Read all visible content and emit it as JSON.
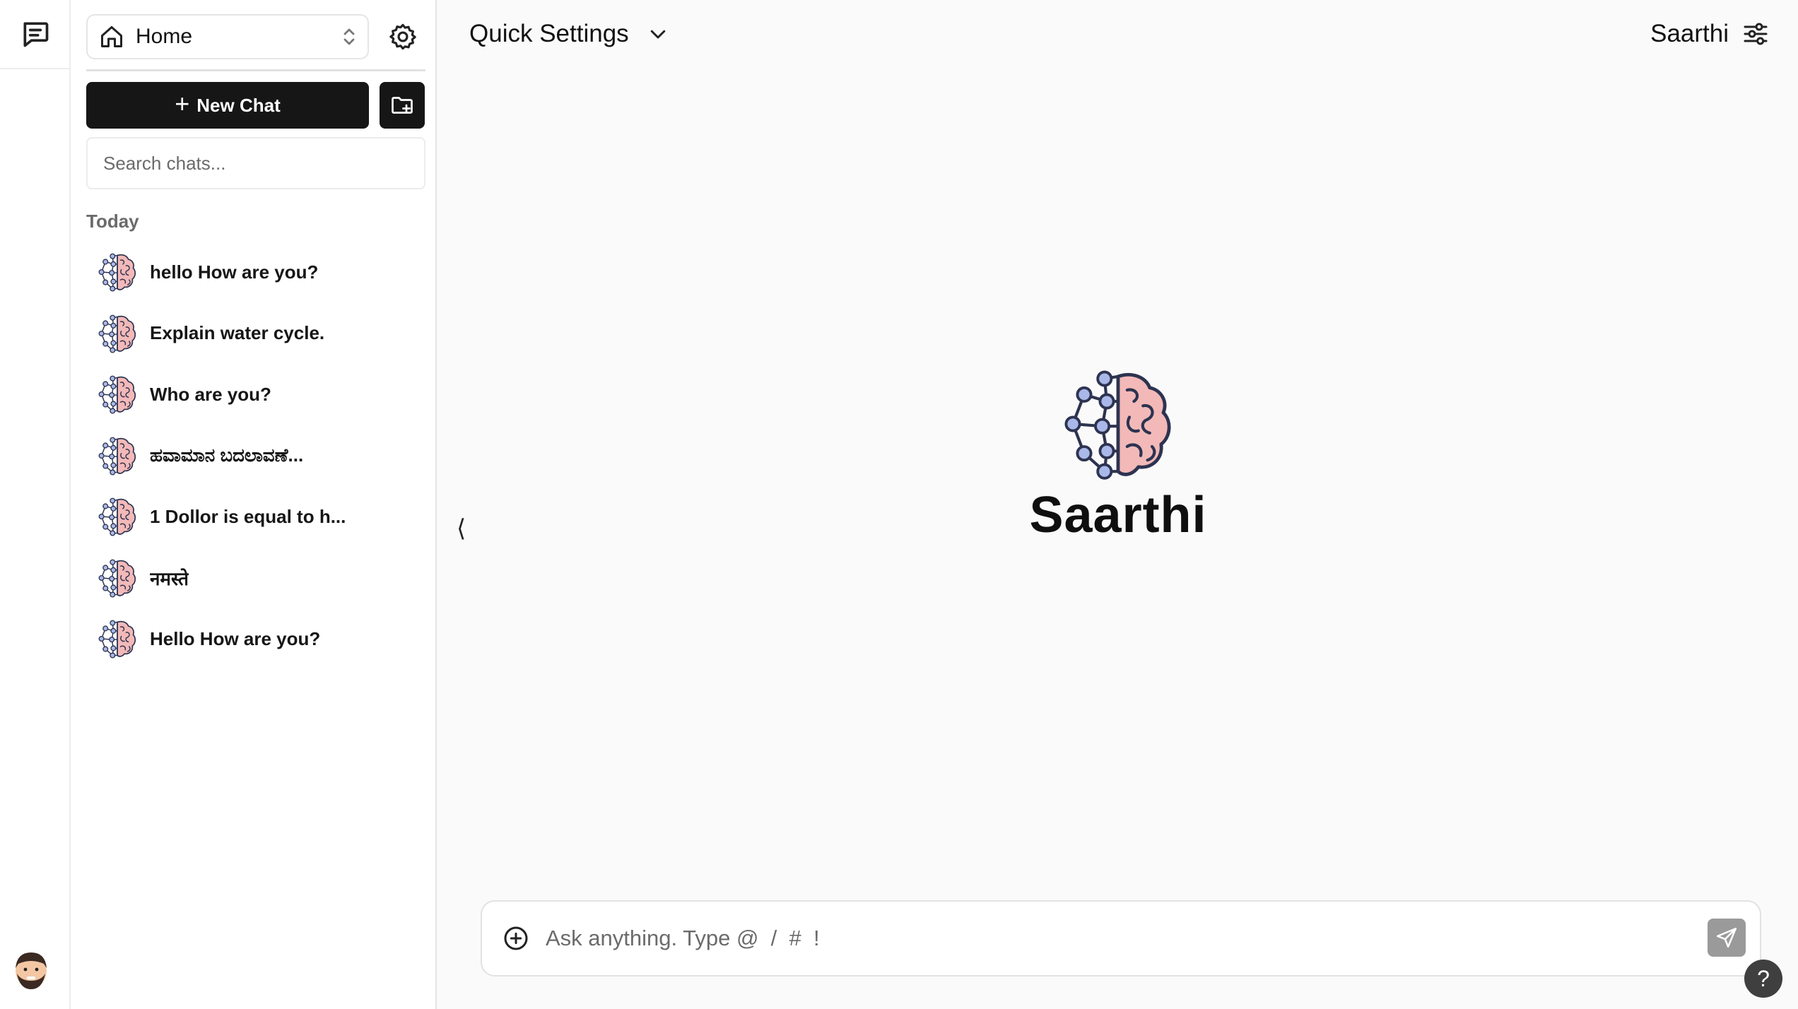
{
  "sidebar": {
    "space_select": {
      "label": "Home",
      "icon": "home-icon"
    },
    "new_chat_label": "New Chat",
    "search": {
      "placeholder": "Search chats..."
    },
    "section_label": "Today",
    "chats": [
      {
        "title": "hello How are you?"
      },
      {
        "title": "Explain water cycle."
      },
      {
        "title": "Who are you?"
      },
      {
        "title": "ಹವಾಮಾನ ಬದಲಾವಣೆ..."
      },
      {
        "title": "1 Dollor is equal to h..."
      },
      {
        "title": "नमस्ते"
      },
      {
        "title": "Hello How are you?"
      }
    ]
  },
  "header": {
    "quick_settings_label": "Quick Settings",
    "model_name": "Saarthi"
  },
  "main": {
    "collapse_glyph": "⟨",
    "hero_title": "Saarthi",
    "composer": {
      "placeholder": "Ask anything. Type @  /  #  !"
    },
    "help_glyph": "?"
  },
  "colors": {
    "accent_dark": "#161616",
    "brain_pink": "#f2b9b8",
    "brain_network": "#a9b8e8"
  }
}
